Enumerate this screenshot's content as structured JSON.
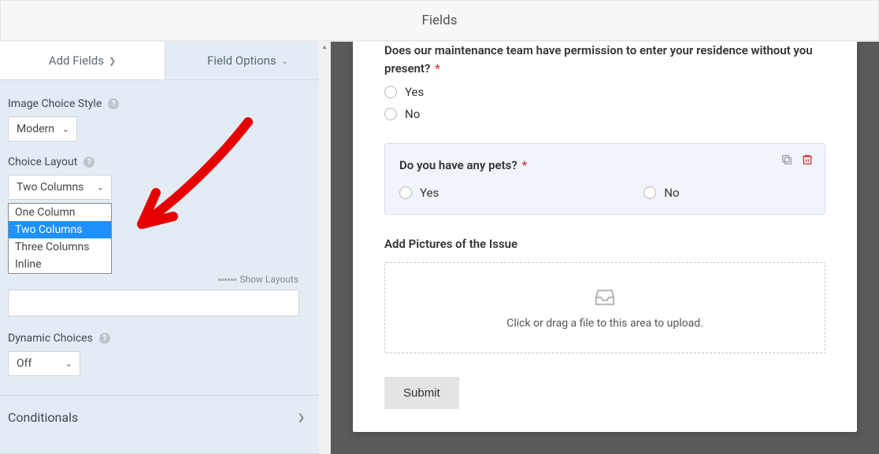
{
  "header": {
    "title": "Fields"
  },
  "sidebar": {
    "tabs": {
      "add": "Add Fields",
      "options": "Field Options"
    },
    "image_choice_style": {
      "label": "Image Choice Style",
      "value": "Modern"
    },
    "choice_layout": {
      "label": "Choice Layout",
      "value": "Two Columns",
      "options": [
        "One Column",
        "Two Columns",
        "Three Columns",
        "Inline"
      ],
      "show_layouts": "Show Layouts"
    },
    "dynamic_choices": {
      "label": "Dynamic Choices",
      "value": "Off"
    },
    "conditionals": {
      "label": "Conditionals"
    }
  },
  "preview": {
    "q1": {
      "text": "Does our maintenance team have permission to enter your residence without you present?",
      "required": "*",
      "opts": [
        "Yes",
        "No"
      ]
    },
    "q2": {
      "text": "Do you have any pets?",
      "required": "*",
      "opts": [
        "Yes",
        "No"
      ]
    },
    "upload": {
      "label": "Add Pictures of the Issue",
      "hint": "Click or drag a file to this area to upload."
    },
    "submit": "Submit"
  }
}
